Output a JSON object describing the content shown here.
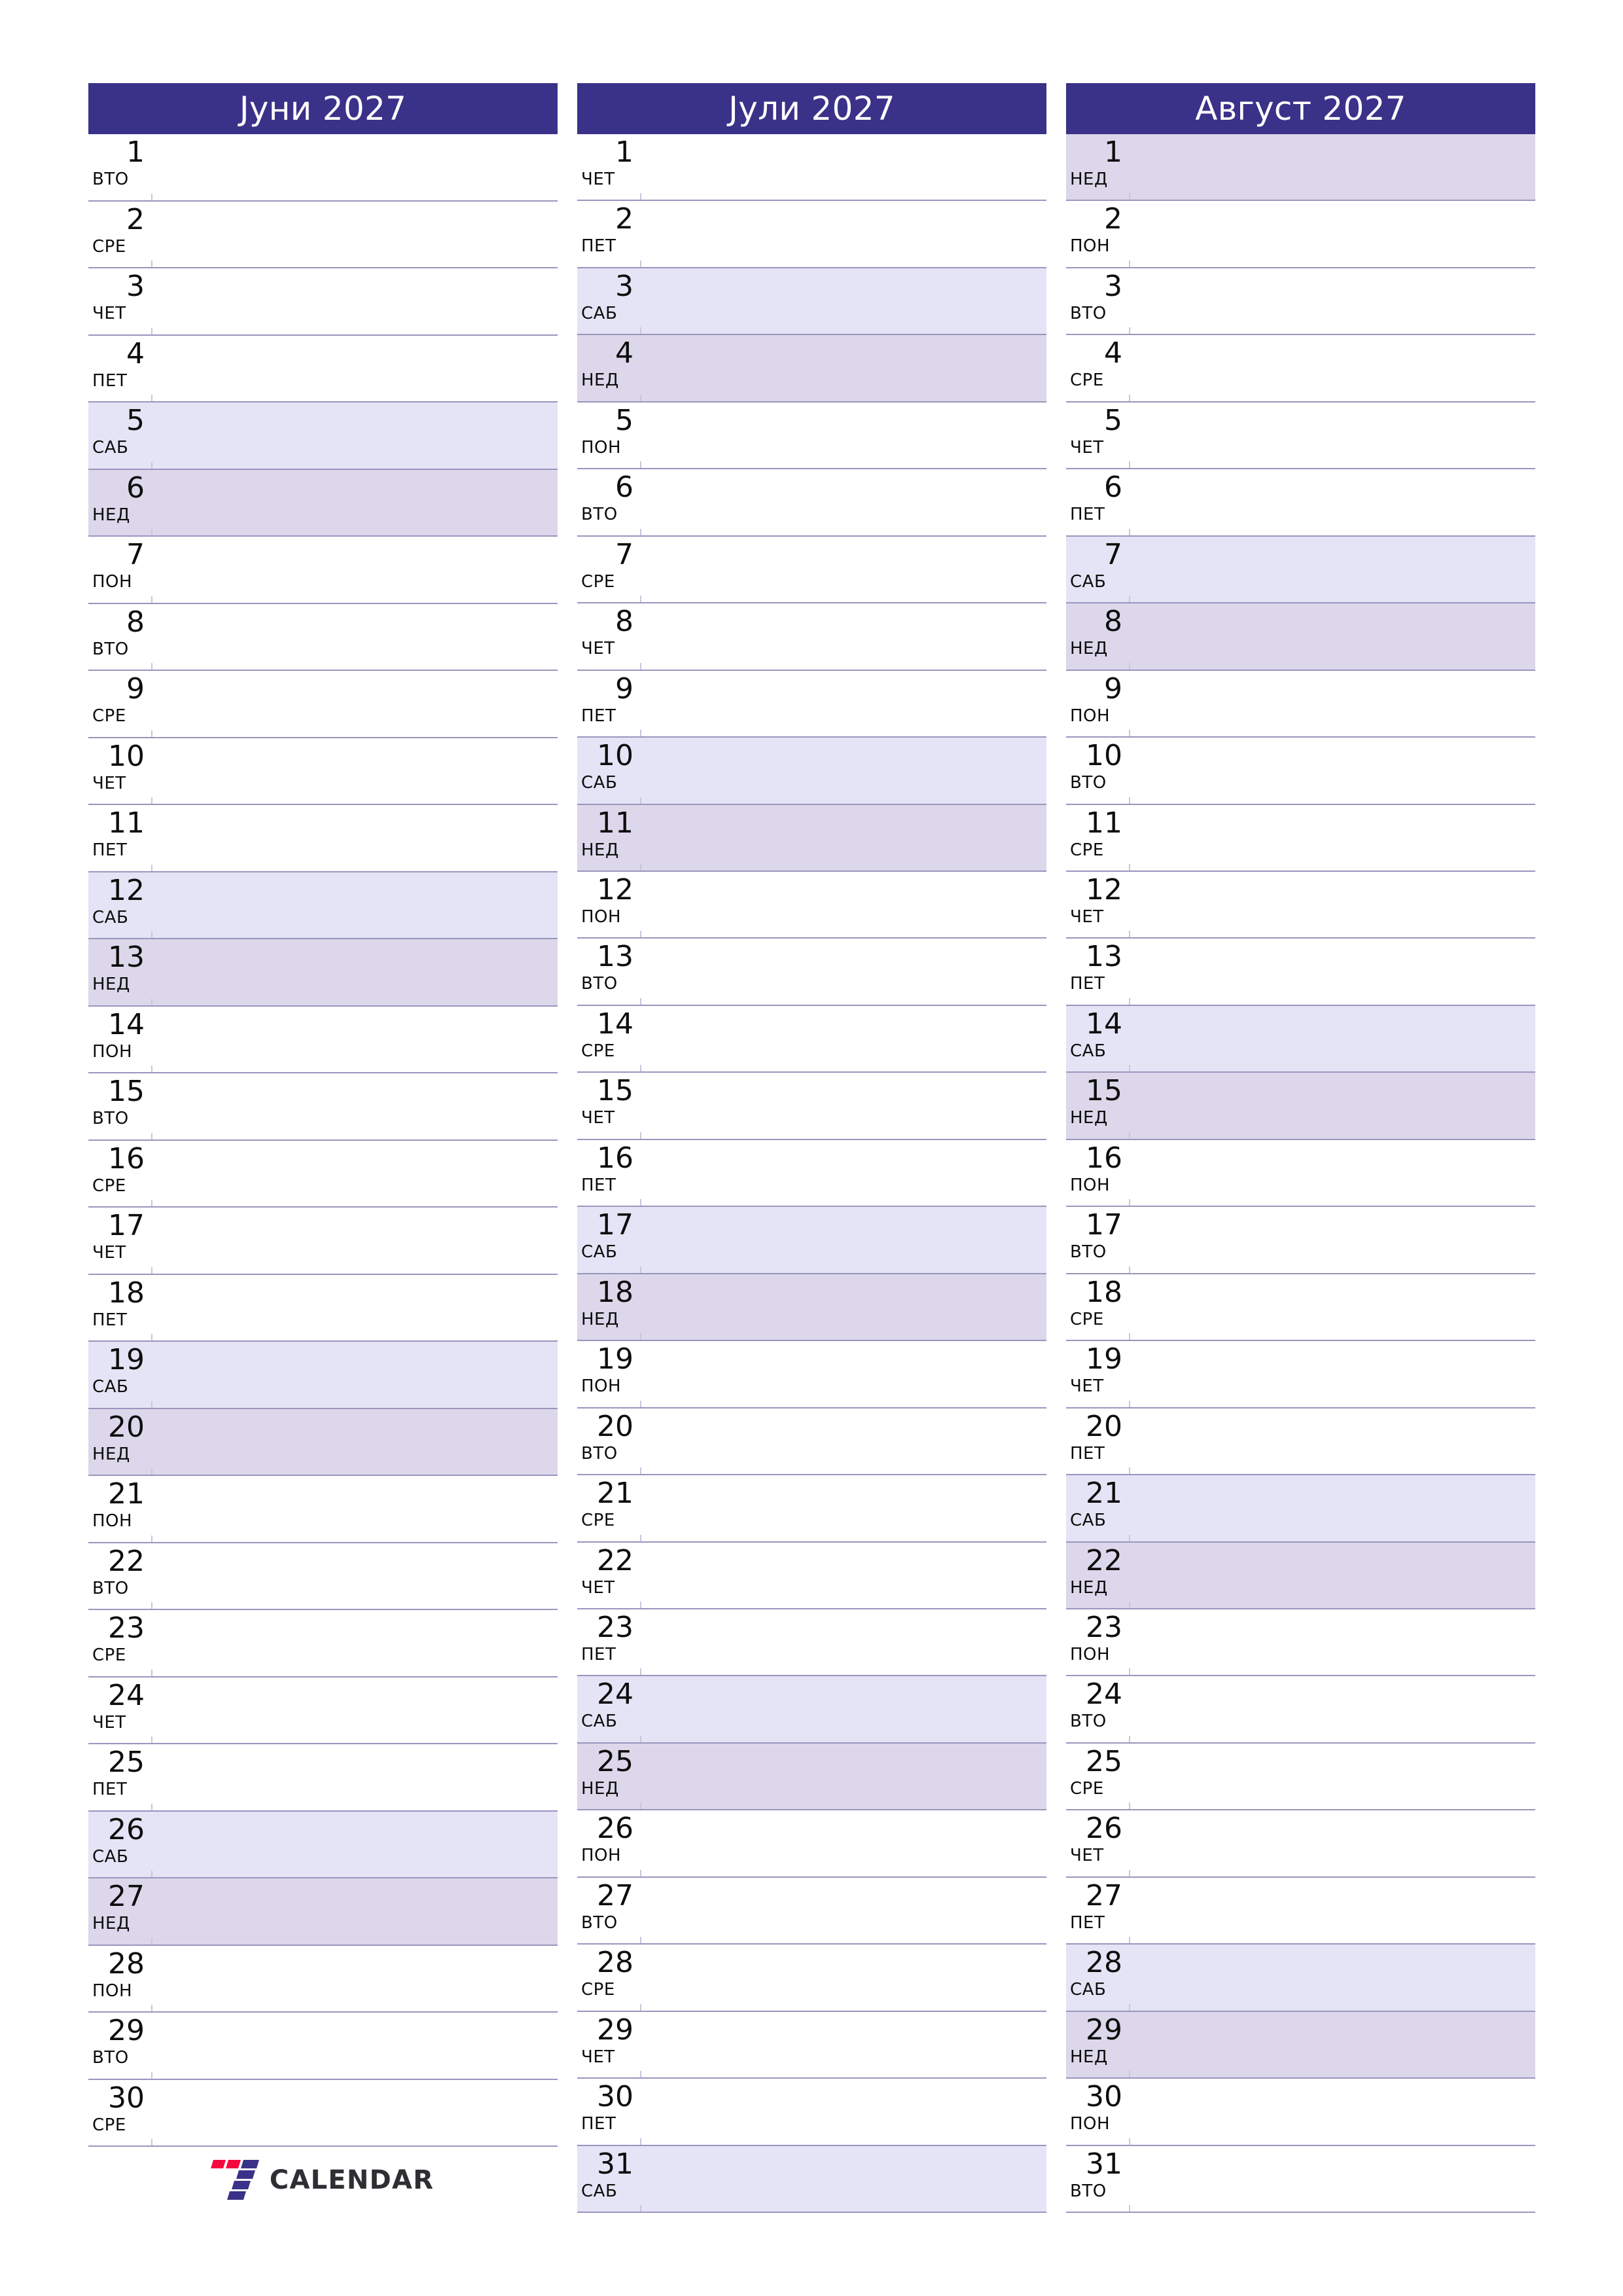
{
  "colors": {
    "header_bg": "#3a3189",
    "header_text": "#ffffff",
    "saturday_bg": "#e4e4f6",
    "sunday_bg": "#dcd7ea",
    "row_separator": "#9a95be",
    "logo_red": "#f5063e",
    "logo_blue": "#3a3189",
    "logo_text": "#2e2e33",
    "page_bg": "#ffffff"
  },
  "brand": {
    "name": "CALENDAR",
    "mark": "seven-logo-mark"
  },
  "months": [
    {
      "title": "Јуни 2027",
      "days": [
        {
          "num": "1",
          "dow": "ВТО",
          "type": "weekday"
        },
        {
          "num": "2",
          "dow": "СРЕ",
          "type": "weekday"
        },
        {
          "num": "3",
          "dow": "ЧЕТ",
          "type": "weekday"
        },
        {
          "num": "4",
          "dow": "ПЕТ",
          "type": "weekday"
        },
        {
          "num": "5",
          "dow": "САБ",
          "type": "sat"
        },
        {
          "num": "6",
          "dow": "НЕД",
          "type": "sun"
        },
        {
          "num": "7",
          "dow": "ПОН",
          "type": "weekday"
        },
        {
          "num": "8",
          "dow": "ВТО",
          "type": "weekday"
        },
        {
          "num": "9",
          "dow": "СРЕ",
          "type": "weekday"
        },
        {
          "num": "10",
          "dow": "ЧЕТ",
          "type": "weekday"
        },
        {
          "num": "11",
          "dow": "ПЕТ",
          "type": "weekday"
        },
        {
          "num": "12",
          "dow": "САБ",
          "type": "sat"
        },
        {
          "num": "13",
          "dow": "НЕД",
          "type": "sun"
        },
        {
          "num": "14",
          "dow": "ПОН",
          "type": "weekday"
        },
        {
          "num": "15",
          "dow": "ВТО",
          "type": "weekday"
        },
        {
          "num": "16",
          "dow": "СРЕ",
          "type": "weekday"
        },
        {
          "num": "17",
          "dow": "ЧЕТ",
          "type": "weekday"
        },
        {
          "num": "18",
          "dow": "ПЕТ",
          "type": "weekday"
        },
        {
          "num": "19",
          "dow": "САБ",
          "type": "sat"
        },
        {
          "num": "20",
          "dow": "НЕД",
          "type": "sun"
        },
        {
          "num": "21",
          "dow": "ПОН",
          "type": "weekday"
        },
        {
          "num": "22",
          "dow": "ВТО",
          "type": "weekday"
        },
        {
          "num": "23",
          "dow": "СРЕ",
          "type": "weekday"
        },
        {
          "num": "24",
          "dow": "ЧЕТ",
          "type": "weekday"
        },
        {
          "num": "25",
          "dow": "ПЕТ",
          "type": "weekday"
        },
        {
          "num": "26",
          "dow": "САБ",
          "type": "sat"
        },
        {
          "num": "27",
          "dow": "НЕД",
          "type": "sun"
        },
        {
          "num": "28",
          "dow": "ПОН",
          "type": "weekday"
        },
        {
          "num": "29",
          "dow": "ВТО",
          "type": "weekday"
        },
        {
          "num": "30",
          "dow": "СРЕ",
          "type": "weekday"
        }
      ],
      "trailing_slot": "logo"
    },
    {
      "title": "Јули 2027",
      "days": [
        {
          "num": "1",
          "dow": "ЧЕТ",
          "type": "weekday"
        },
        {
          "num": "2",
          "dow": "ПЕТ",
          "type": "weekday"
        },
        {
          "num": "3",
          "dow": "САБ",
          "type": "sat"
        },
        {
          "num": "4",
          "dow": "НЕД",
          "type": "sun"
        },
        {
          "num": "5",
          "dow": "ПОН",
          "type": "weekday"
        },
        {
          "num": "6",
          "dow": "ВТО",
          "type": "weekday"
        },
        {
          "num": "7",
          "dow": "СРЕ",
          "type": "weekday"
        },
        {
          "num": "8",
          "dow": "ЧЕТ",
          "type": "weekday"
        },
        {
          "num": "9",
          "dow": "ПЕТ",
          "type": "weekday"
        },
        {
          "num": "10",
          "dow": "САБ",
          "type": "sat"
        },
        {
          "num": "11",
          "dow": "НЕД",
          "type": "sun"
        },
        {
          "num": "12",
          "dow": "ПОН",
          "type": "weekday"
        },
        {
          "num": "13",
          "dow": "ВТО",
          "type": "weekday"
        },
        {
          "num": "14",
          "dow": "СРЕ",
          "type": "weekday"
        },
        {
          "num": "15",
          "dow": "ЧЕТ",
          "type": "weekday"
        },
        {
          "num": "16",
          "dow": "ПЕТ",
          "type": "weekday"
        },
        {
          "num": "17",
          "dow": "САБ",
          "type": "sat"
        },
        {
          "num": "18",
          "dow": "НЕД",
          "type": "sun"
        },
        {
          "num": "19",
          "dow": "ПОН",
          "type": "weekday"
        },
        {
          "num": "20",
          "dow": "ВТО",
          "type": "weekday"
        },
        {
          "num": "21",
          "dow": "СРЕ",
          "type": "weekday"
        },
        {
          "num": "22",
          "dow": "ЧЕТ",
          "type": "weekday"
        },
        {
          "num": "23",
          "dow": "ПЕТ",
          "type": "weekday"
        },
        {
          "num": "24",
          "dow": "САБ",
          "type": "sat"
        },
        {
          "num": "25",
          "dow": "НЕД",
          "type": "sun"
        },
        {
          "num": "26",
          "dow": "ПОН",
          "type": "weekday"
        },
        {
          "num": "27",
          "dow": "ВТО",
          "type": "weekday"
        },
        {
          "num": "28",
          "dow": "СРЕ",
          "type": "weekday"
        },
        {
          "num": "29",
          "dow": "ЧЕТ",
          "type": "weekday"
        },
        {
          "num": "30",
          "dow": "ПЕТ",
          "type": "weekday"
        },
        {
          "num": "31",
          "dow": "САБ",
          "type": "sat"
        }
      ],
      "trailing_slot": "none"
    },
    {
      "title": "Август 2027",
      "days": [
        {
          "num": "1",
          "dow": "НЕД",
          "type": "sun"
        },
        {
          "num": "2",
          "dow": "ПОН",
          "type": "weekday"
        },
        {
          "num": "3",
          "dow": "ВТО",
          "type": "weekday"
        },
        {
          "num": "4",
          "dow": "СРЕ",
          "type": "weekday"
        },
        {
          "num": "5",
          "dow": "ЧЕТ",
          "type": "weekday"
        },
        {
          "num": "6",
          "dow": "ПЕТ",
          "type": "weekday"
        },
        {
          "num": "7",
          "dow": "САБ",
          "type": "sat"
        },
        {
          "num": "8",
          "dow": "НЕД",
          "type": "sun"
        },
        {
          "num": "9",
          "dow": "ПОН",
          "type": "weekday"
        },
        {
          "num": "10",
          "dow": "ВТО",
          "type": "weekday"
        },
        {
          "num": "11",
          "dow": "СРЕ",
          "type": "weekday"
        },
        {
          "num": "12",
          "dow": "ЧЕТ",
          "type": "weekday"
        },
        {
          "num": "13",
          "dow": "ПЕТ",
          "type": "weekday"
        },
        {
          "num": "14",
          "dow": "САБ",
          "type": "sat"
        },
        {
          "num": "15",
          "dow": "НЕД",
          "type": "sun"
        },
        {
          "num": "16",
          "dow": "ПОН",
          "type": "weekday"
        },
        {
          "num": "17",
          "dow": "ВТО",
          "type": "weekday"
        },
        {
          "num": "18",
          "dow": "СРЕ",
          "type": "weekday"
        },
        {
          "num": "19",
          "dow": "ЧЕТ",
          "type": "weekday"
        },
        {
          "num": "20",
          "dow": "ПЕТ",
          "type": "weekday"
        },
        {
          "num": "21",
          "dow": "САБ",
          "type": "sat"
        },
        {
          "num": "22",
          "dow": "НЕД",
          "type": "sun"
        },
        {
          "num": "23",
          "dow": "ПОН",
          "type": "weekday"
        },
        {
          "num": "24",
          "dow": "ВТО",
          "type": "weekday"
        },
        {
          "num": "25",
          "dow": "СРЕ",
          "type": "weekday"
        },
        {
          "num": "26",
          "dow": "ЧЕТ",
          "type": "weekday"
        },
        {
          "num": "27",
          "dow": "ПЕТ",
          "type": "weekday"
        },
        {
          "num": "28",
          "dow": "САБ",
          "type": "sat"
        },
        {
          "num": "29",
          "dow": "НЕД",
          "type": "sun"
        },
        {
          "num": "30",
          "dow": "ПОН",
          "type": "weekday"
        },
        {
          "num": "31",
          "dow": "ВТО",
          "type": "weekday"
        }
      ],
      "trailing_slot": "none"
    }
  ]
}
